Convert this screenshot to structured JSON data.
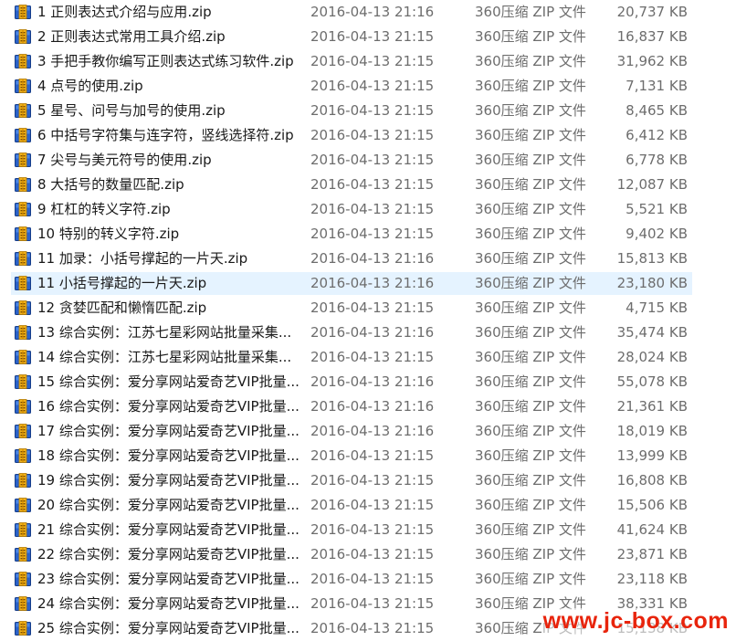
{
  "files": [
    {
      "name": "1 正则表达式介绍与应用.zip",
      "date": "2016-04-13 21:16",
      "type": "360压缩 ZIP 文件",
      "size": "20,737 KB",
      "selected": false
    },
    {
      "name": "2 正则表达式常用工具介绍.zip",
      "date": "2016-04-13 21:15",
      "type": "360压缩 ZIP 文件",
      "size": "16,837 KB",
      "selected": false
    },
    {
      "name": "3 手把手教你编写正则表达式练习软件.zip",
      "date": "2016-04-13 21:15",
      "type": "360压缩 ZIP 文件",
      "size": "31,962 KB",
      "selected": false
    },
    {
      "name": "4 点号的使用.zip",
      "date": "2016-04-13 21:15",
      "type": "360压缩 ZIP 文件",
      "size": "7,131 KB",
      "selected": false
    },
    {
      "name": "5 星号、问号与加号的使用.zip",
      "date": "2016-04-13 21:15",
      "type": "360压缩 ZIP 文件",
      "size": "8,465 KB",
      "selected": false
    },
    {
      "name": "6 中括号字符集与连字符，竖线选择符.zip",
      "date": "2016-04-13 21:15",
      "type": "360压缩 ZIP 文件",
      "size": "6,412 KB",
      "selected": false
    },
    {
      "name": "7 尖号与美元符号的使用.zip",
      "date": "2016-04-13 21:15",
      "type": "360压缩 ZIP 文件",
      "size": "6,778 KB",
      "selected": false
    },
    {
      "name": "8 大括号的数量匹配.zip",
      "date": "2016-04-13 21:15",
      "type": "360压缩 ZIP 文件",
      "size": "12,087 KB",
      "selected": false
    },
    {
      "name": "9 杠杠的转义字符.zip",
      "date": "2016-04-13 21:15",
      "type": "360压缩 ZIP 文件",
      "size": "5,521 KB",
      "selected": false
    },
    {
      "name": "10 特别的转义字符.zip",
      "date": "2016-04-13 21:15",
      "type": "360压缩 ZIP 文件",
      "size": "9,402 KB",
      "selected": false
    },
    {
      "name": "11 加录：小括号撑起的一片天.zip",
      "date": "2016-04-13 21:16",
      "type": "360压缩 ZIP 文件",
      "size": "15,813 KB",
      "selected": false
    },
    {
      "name": "11 小括号撑起的一片天.zip",
      "date": "2016-04-13 21:16",
      "type": "360压缩 ZIP 文件",
      "size": "23,180 KB",
      "selected": true
    },
    {
      "name": "12 贪婪匹配和懒惰匹配.zip",
      "date": "2016-04-13 21:15",
      "type": "360压缩 ZIP 文件",
      "size": "4,715 KB",
      "selected": false
    },
    {
      "name": "13 综合实例：江苏七星彩网站批量采集...",
      "date": "2016-04-13 21:16",
      "type": "360压缩 ZIP 文件",
      "size": "35,474 KB",
      "selected": false
    },
    {
      "name": "14 综合实例：江苏七星彩网站批量采集...",
      "date": "2016-04-13 21:15",
      "type": "360压缩 ZIP 文件",
      "size": "28,024 KB",
      "selected": false
    },
    {
      "name": "15 综合实例：爱分享网站爱奇艺VIP批量...",
      "date": "2016-04-13 21:16",
      "type": "360压缩 ZIP 文件",
      "size": "55,078 KB",
      "selected": false
    },
    {
      "name": "16 综合实例：爱分享网站爱奇艺VIP批量...",
      "date": "2016-04-13 21:16",
      "type": "360压缩 ZIP 文件",
      "size": "21,361 KB",
      "selected": false
    },
    {
      "name": "17 综合实例：爱分享网站爱奇艺VIP批量...",
      "date": "2016-04-13 21:16",
      "type": "360压缩 ZIP 文件",
      "size": "18,019 KB",
      "selected": false
    },
    {
      "name": "18 综合实例：爱分享网站爱奇艺VIP批量...",
      "date": "2016-04-13 21:15",
      "type": "360压缩 ZIP 文件",
      "size": "13,999 KB",
      "selected": false
    },
    {
      "name": "19 综合实例：爱分享网站爱奇艺VIP批量...",
      "date": "2016-04-13 21:15",
      "type": "360压缩 ZIP 文件",
      "size": "16,808 KB",
      "selected": false
    },
    {
      "name": "20 综合实例：爱分享网站爱奇艺VIP批量...",
      "date": "2016-04-13 21:15",
      "type": "360压缩 ZIP 文件",
      "size": "15,506 KB",
      "selected": false
    },
    {
      "name": "21 综合实例：爱分享网站爱奇艺VIP批量...",
      "date": "2016-04-13 21:15",
      "type": "360压缩 ZIP 文件",
      "size": "41,624 KB",
      "selected": false
    },
    {
      "name": "22 综合实例：爱分享网站爱奇艺VIP批量...",
      "date": "2016-04-13 21:15",
      "type": "360压缩 ZIP 文件",
      "size": "23,871 KB",
      "selected": false
    },
    {
      "name": "23 综合实例：爱分享网站爱奇艺VIP批量...",
      "date": "2016-04-13 21:15",
      "type": "360压缩 ZIP 文件",
      "size": "23,118 KB",
      "selected": false
    },
    {
      "name": "24 综合实例：爱分享网站爱奇艺VIP批量...",
      "date": "2016-04-13 21:15",
      "type": "360压缩 ZIP 文件",
      "size": "38,331 KB",
      "selected": false
    },
    {
      "name": "25 综合实例：爱分享网站爱奇艺VIP批量...",
      "date": "2016-04-13 21:15",
      "type": "360压缩 ZIP 文件",
      "size": "15,138 KB",
      "selected": false
    }
  ],
  "icon": {
    "name": "zip-archive-icon"
  },
  "colors": {
    "selection": "#e5f3ff",
    "text_primary": "#1a1a1a",
    "text_secondary": "#6d6d6d",
    "watermark": "#e8240c"
  },
  "watermark": {
    "text": "www.jc-box.com"
  }
}
